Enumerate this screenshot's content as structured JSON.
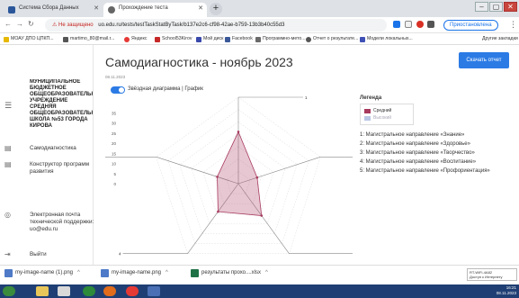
{
  "browser": {
    "tabs": [
      {
        "label": "Система Сбора Данных",
        "active": false
      },
      {
        "label": "Прохождение теста",
        "active": true
      }
    ],
    "address": {
      "warning": "Не защищено",
      "url": "uo.edu.ru/tests/testTaskStatByTask/b137e2c6-cf98-42ae-b759-13b3b40c55d3"
    },
    "profile_label": "Приостановлена",
    "bookmarks": [
      {
        "label": "МОАУ ДПО ЦПКП...",
        "color": "#e6b800"
      },
      {
        "label": "martimo_80@mail.r...",
        "color": "#555555"
      },
      {
        "label": "Яндекс",
        "color": "#e53935"
      },
      {
        "label": "School53Kirov",
        "color": "#c62828"
      },
      {
        "label": "Мой диск",
        "color": "#3949ab"
      },
      {
        "label": "Facebook",
        "color": "#3b5998"
      },
      {
        "label": "Программно-мето...",
        "color": "#6a6a6a"
      },
      {
        "label": "Отчет о результате...",
        "color": "#555555"
      },
      {
        "label": "Модели локальных...",
        "color": "#3f51b5"
      }
    ],
    "other_bookmarks": "Другие закладки"
  },
  "sidebar": {
    "org_name": "МУНИЦИПАЛЬНОЕ БЮДЖЕТНОЕ ОБЩЕОБРАЗОВАТЕЛЬНОЕ УЧРЕЖДЕНИЕ СРЕДНЯЯ ОБЩЕОБРАЗОВАТЕЛЬНАЯ ШКОЛА №53 ГОРОДА КИРОВА",
    "items": [
      {
        "label": "Самодиагностика"
      },
      {
        "label": "Конструктор программ развития"
      },
      {
        "label": "Электронная почта технической поддержки: uo@edu.ru"
      },
      {
        "label": "Выйти"
      }
    ]
  },
  "main": {
    "title": "Самодиагностика - ноябрь 2023",
    "date": "08.11.2023",
    "download_button": "Скачать отчет",
    "toggle_label": "Звёздная диаграмма | График",
    "legend": {
      "title": "Легенда",
      "entries": [
        {
          "label": "Средний",
          "color": "#a83a5e",
          "active": true
        },
        {
          "label": "Высокий",
          "color": "#b9c6e4",
          "active": false
        }
      ],
      "directions": [
        "1: Магистральное направление «Знание»",
        "2: Магистральное направление «Здоровье»",
        "3: Магистральное направление «Творчество»",
        "4: Магистральное направление «Воспитание»",
        "5: Магистральное направление «Профориентация»"
      ]
    }
  },
  "chart_data": {
    "type": "radar",
    "categories": [
      "1",
      "2",
      "3",
      "4",
      "5"
    ],
    "rlim": [
      0,
      35
    ],
    "ticks": [
      0,
      5,
      10,
      15,
      20,
      25,
      30,
      35
    ],
    "series": [
      {
        "name": "Средний",
        "values": [
          21,
          8,
          16,
          14,
          9
        ],
        "color": "#a83a5e"
      }
    ]
  },
  "downloads": [
    {
      "label": "my-image-name (1).png"
    },
    {
      "label": "my-image-name.png"
    },
    {
      "label": "результаты прохо....xlsx"
    }
  ],
  "network_tip": {
    "name": "RT-WiFi-4A82",
    "status": "Доступ к Интернету"
  },
  "taskbar": {
    "time": "16:21",
    "date": "08.11.2023"
  }
}
